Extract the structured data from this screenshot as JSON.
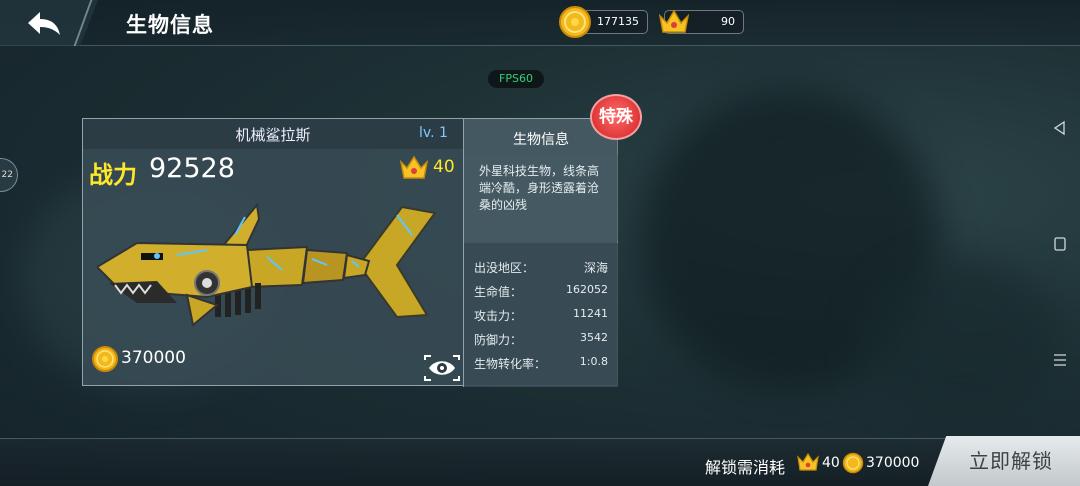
{
  "header": {
    "title": "生物信息",
    "coins": "177135",
    "crowns": "90"
  },
  "debug": {
    "fps": "FPS60"
  },
  "side": {
    "left_badge": "22"
  },
  "creature": {
    "name": "机械鲨拉斯",
    "level": "lv. 1",
    "power_label": "战力",
    "power_value": "92528",
    "crown_requirement": "40",
    "price": "370000",
    "badge": "特殊"
  },
  "info": {
    "title": "生物信息",
    "description": "外星科技生物，线条高端冷酷，身形透露着沧桑的凶残",
    "stats": [
      {
        "label": "出没地区：",
        "value": "深海"
      },
      {
        "label": "生命值：",
        "value": "162052"
      },
      {
        "label": "攻击力：",
        "value": "11241"
      },
      {
        "label": "防御力：",
        "value": "3542"
      },
      {
        "label": "生物转化率：",
        "value": "1:0.8"
      }
    ]
  },
  "footer": {
    "unlock_label": "解锁需消耗",
    "unlock_crowns": "40",
    "unlock_coins": "370000",
    "unlock_button": "立即解锁"
  },
  "colors": {
    "power_yellow": "#ffe82a",
    "level_blue": "#7fc7ff",
    "badge_red": "#e23b3b",
    "fps_green": "#36d07a"
  },
  "icons": [
    "back-arrow-icon",
    "coin-icon",
    "crown-icon",
    "eye-icon",
    "android-back-icon",
    "android-home-icon",
    "android-menu-icon"
  ]
}
